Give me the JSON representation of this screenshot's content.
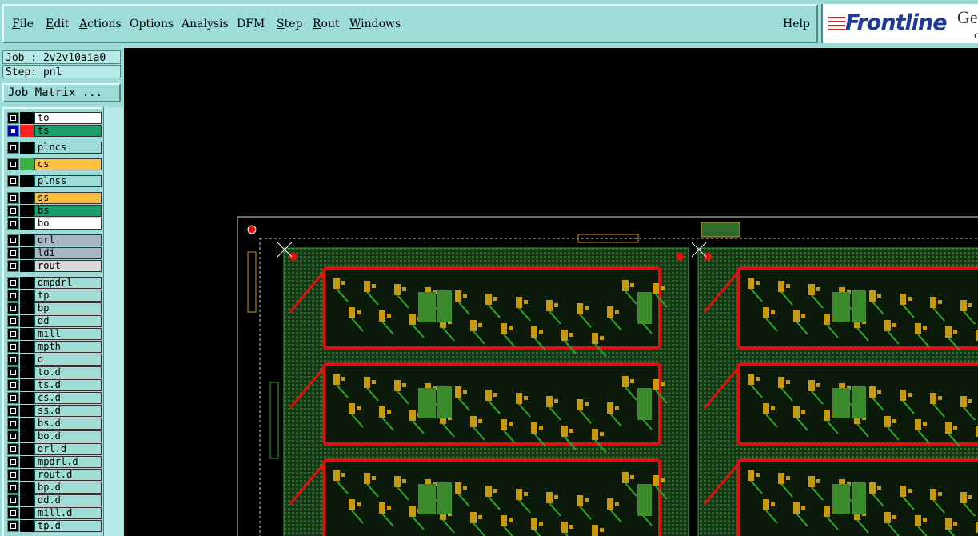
{
  "menu": {
    "items": [
      "File",
      "Edit",
      "Actions",
      "Options",
      "Analysis",
      "DFM",
      "Step",
      "Rout",
      "Windows"
    ],
    "help": "Help"
  },
  "logo": {
    "text": "Frontline",
    "ge": "Ge",
    "small": "c"
  },
  "job": {
    "job_label": "Job : 2v2v10aia0",
    "step_label": "Step: pnl",
    "matrix_button": "Job Matrix ..."
  },
  "layers": [
    {
      "name": "to",
      "color": "#000000",
      "bg": "#ffffff",
      "active": false
    },
    {
      "name": "ts",
      "color": "#ff2020",
      "bg": "#17a06a",
      "active": true
    },
    {
      "name": "plncs",
      "color": "#000000",
      "bg": "#9edcd8",
      "active": false
    },
    {
      "name": "cs",
      "color": "#3cb043",
      "bg": "#ffc040",
      "active": false
    },
    {
      "name": "plnss",
      "color": "#000000",
      "bg": "#9edcd8",
      "active": false
    },
    {
      "name": "ss",
      "color": "#000000",
      "bg": "#ffc040",
      "active": false
    },
    {
      "name": "bs",
      "color": "#000000",
      "bg": "#17a06a",
      "active": false
    },
    {
      "name": "bo",
      "color": "#000000",
      "bg": "#ffffff",
      "active": false
    },
    {
      "name": "drl",
      "color": "#000000",
      "bg": "#a8b8c0",
      "active": false
    },
    {
      "name": "ldi",
      "color": "#000000",
      "bg": "#a8b8c0",
      "active": false
    },
    {
      "name": "rout",
      "color": "#000000",
      "bg": "#d8d8d8",
      "active": false
    },
    {
      "name": "dmpdrl",
      "color": "#000000",
      "bg": "#9edcd8",
      "active": false
    },
    {
      "name": "tp",
      "color": "#000000",
      "bg": "#9edcd8",
      "active": false
    },
    {
      "name": "bp",
      "color": "#000000",
      "bg": "#9edcd8",
      "active": false
    },
    {
      "name": "dd",
      "color": "#000000",
      "bg": "#9edcd8",
      "active": false
    },
    {
      "name": "mill",
      "color": "#000000",
      "bg": "#9edcd8",
      "active": false
    },
    {
      "name": "mpth",
      "color": "#000000",
      "bg": "#9edcd8",
      "active": false
    },
    {
      "name": "d",
      "color": "#000000",
      "bg": "#9edcd8",
      "active": false
    },
    {
      "name": "to.d",
      "color": "#000000",
      "bg": "#9edcd8",
      "active": false
    },
    {
      "name": "ts.d",
      "color": "#000000",
      "bg": "#9edcd8",
      "active": false
    },
    {
      "name": "cs.d",
      "color": "#000000",
      "bg": "#9edcd8",
      "active": false
    },
    {
      "name": "ss.d",
      "color": "#000000",
      "bg": "#9edcd8",
      "active": false
    },
    {
      "name": "bs.d",
      "color": "#000000",
      "bg": "#9edcd8",
      "active": false
    },
    {
      "name": "bo.d",
      "color": "#000000",
      "bg": "#9edcd8",
      "active": false
    },
    {
      "name": "drl.d",
      "color": "#000000",
      "bg": "#9edcd8",
      "active": false
    },
    {
      "name": "mpdrl.d",
      "color": "#000000",
      "bg": "#9edcd8",
      "active": false
    },
    {
      "name": "rout.d",
      "color": "#000000",
      "bg": "#9edcd8",
      "active": false
    },
    {
      "name": "bp.d",
      "color": "#000000",
      "bg": "#9edcd8",
      "active": false
    },
    {
      "name": "dd.d",
      "color": "#000000",
      "bg": "#9edcd8",
      "active": false
    },
    {
      "name": "mill.d",
      "color": "#000000",
      "bg": "#9edcd8",
      "active": false
    },
    {
      "name": "tp.d",
      "color": "#000000",
      "bg": "#9edcd8",
      "active": false
    }
  ],
  "colors": {
    "panel_bg": "#9edcd8",
    "pcb_green": "#1f4f1c",
    "pcb_trace": "#2fa62f",
    "pcb_pad": "#c89a12",
    "pcb_outline": "#e01010"
  }
}
